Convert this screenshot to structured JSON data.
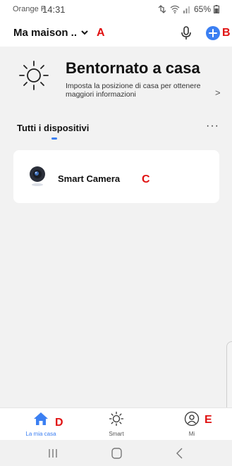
{
  "status_bar": {
    "carrier": "Orange F",
    "time": "14:31",
    "battery": "65%"
  },
  "header": {
    "home_name": "Ma maison ..",
    "chevron_icon": "chevron-down-icon",
    "mic_icon": "microphone-icon",
    "add_icon": "plus-circle-icon"
  },
  "welcome": {
    "title": "Bentornato a casa",
    "subtitle": "Imposta la posizione di casa per ottenere maggiori informazioni",
    "arrow": ">"
  },
  "devices": {
    "section_title": "Tutti i dispositivi",
    "more_label": "···",
    "items": [
      {
        "name": "Smart Camera",
        "icon": "camera-icon"
      }
    ]
  },
  "tabs": [
    {
      "label": "La mia casa",
      "icon": "home-icon",
      "active": true
    },
    {
      "label": "Smart",
      "icon": "sun-icon",
      "active": false
    },
    {
      "label": "Mi",
      "icon": "user-icon",
      "active": false
    }
  ],
  "annotations": {
    "a": "A",
    "b": "B",
    "c": "C",
    "d": "D",
    "e": "E"
  },
  "colors": {
    "accent": "#3b7ff2",
    "annotation": "#e01010",
    "background": "#f2f2f2"
  }
}
